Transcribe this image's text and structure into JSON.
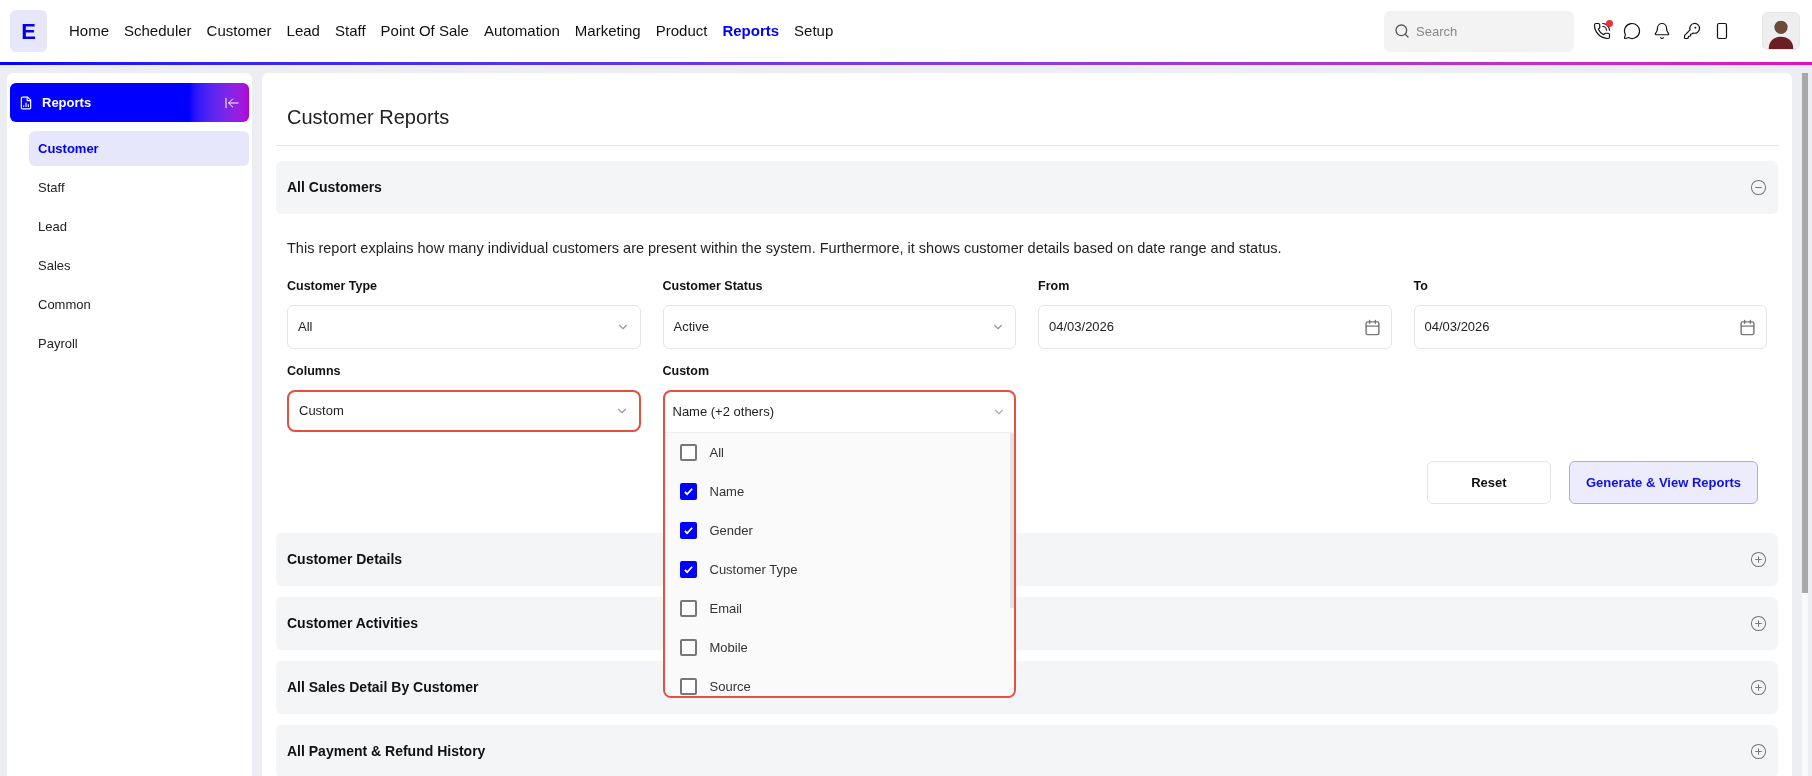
{
  "logo": {
    "letter": "E"
  },
  "nav": [
    {
      "label": "Home",
      "selected": false
    },
    {
      "label": "Scheduler",
      "selected": false
    },
    {
      "label": "Customer",
      "selected": false
    },
    {
      "label": "Lead",
      "selected": false
    },
    {
      "label": "Staff",
      "selected": false
    },
    {
      "label": "Point Of Sale",
      "selected": false
    },
    {
      "label": "Automation",
      "selected": false
    },
    {
      "label": "Marketing",
      "selected": false
    },
    {
      "label": "Product",
      "selected": false
    },
    {
      "label": "Reports",
      "selected": true
    },
    {
      "label": "Setup",
      "selected": false
    }
  ],
  "search": {
    "placeholder": "Search"
  },
  "header_icons": [
    {
      "kind": "phone",
      "badge": true
    },
    {
      "kind": "chat",
      "badge": false
    },
    {
      "kind": "bell",
      "badge": false
    },
    {
      "kind": "key",
      "badge": false
    },
    {
      "kind": "device",
      "badge": false
    }
  ],
  "sidebar": {
    "title": "Reports",
    "items": [
      {
        "label": "Customer",
        "selected": true
      },
      {
        "label": "Staff",
        "selected": false
      },
      {
        "label": "Lead",
        "selected": false
      },
      {
        "label": "Sales",
        "selected": false
      },
      {
        "label": "Common",
        "selected": false
      },
      {
        "label": "Payroll",
        "selected": false
      }
    ]
  },
  "page_title": "Customer Reports",
  "sections": [
    {
      "title": "All Customers",
      "expanded": true
    },
    {
      "title": "Customer Details",
      "expanded": false
    },
    {
      "title": "Customer Activities",
      "expanded": false
    },
    {
      "title": "All Sales Detail By Customer",
      "expanded": false
    },
    {
      "title": "All Payment & Refund History",
      "expanded": false
    }
  ],
  "report": {
    "description": "This report explains how many individual customers are present within the system. Furthermore, it shows customer details based on date range and status.",
    "fields": [
      {
        "kind": "select",
        "label": "Customer Type",
        "value": "All",
        "highlighted": false
      },
      {
        "kind": "select",
        "label": "Customer Status",
        "value": "Active",
        "highlighted": false
      },
      {
        "kind": "date",
        "label": "From",
        "value": "04/03/2026",
        "highlighted": false
      },
      {
        "kind": "date",
        "label": "To",
        "value": "04/03/2026",
        "highlighted": false
      },
      {
        "kind": "select",
        "label": "Columns",
        "value": "Custom",
        "highlighted": true
      },
      {
        "kind": "multiselect",
        "label": "Custom",
        "value": "Name (+2 others)",
        "highlighted": true,
        "expanded": true,
        "options": [
          {
            "label": "All",
            "checked": false
          },
          {
            "label": "Name",
            "checked": true
          },
          {
            "label": "Gender",
            "checked": true
          },
          {
            "label": "Customer Type",
            "checked": true
          },
          {
            "label": "Email",
            "checked": false
          },
          {
            "label": "Mobile",
            "checked": false
          },
          {
            "label": "Source",
            "checked": false
          }
        ]
      }
    ],
    "buttons": [
      {
        "label": "Reset",
        "kind": "secondary"
      },
      {
        "label": "Generate & View Reports",
        "kind": "primary"
      }
    ]
  }
}
